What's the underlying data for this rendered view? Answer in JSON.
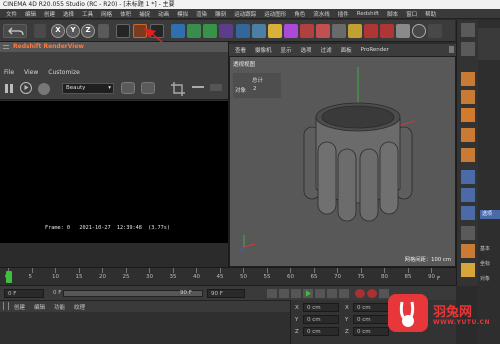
{
  "window": {
    "title": "CINEMA 4D R20.055 Studio (RC - R20) - [未标题 1 *] - 主要"
  },
  "menubar": [
    "文件",
    "编辑",
    "创建",
    "选择",
    "工具",
    "网格",
    "体积",
    "捕捉",
    "动画",
    "模拟",
    "渲染",
    "雕刻",
    "运动跟踪",
    "运动图形",
    "角色",
    "流水线",
    "插件",
    "Redshift",
    "脚本",
    "窗口",
    "帮助"
  ],
  "toolbar": {
    "axes": [
      "X",
      "Y",
      "Z"
    ]
  },
  "renderview": {
    "title": "Redshift RenderView",
    "menu": [
      "File",
      "View",
      "Customize"
    ],
    "beauty_select": "Beauty",
    "frame_label": "Frame: 0",
    "date": "2021-10-27",
    "time": "12:39:48",
    "duration": "(3.77s)"
  },
  "viewport": {
    "menu": [
      "查看",
      "摄像机",
      "显示",
      "选项",
      "过滤",
      "面板",
      "ProRender"
    ],
    "label": "透视视图",
    "stats_header": "总计",
    "stats_label": "对象",
    "stats_value": "2",
    "grid_spacing": "网格间距：100 cm"
  },
  "timeline": {
    "ticks": [
      "0",
      "5",
      "10",
      "15",
      "20",
      "25",
      "30",
      "35",
      "40",
      "45",
      "50",
      "55",
      "60",
      "65",
      "70",
      "75",
      "80",
      "85",
      "90"
    ],
    "unit_suffix": "F"
  },
  "transport": {
    "current": "0 F",
    "start": "0 F",
    "end_field": "90 F",
    "end": "90 F"
  },
  "material_tabs": [
    "创建",
    "编辑",
    "功能",
    "纹理"
  ],
  "coords": {
    "rows": [
      [
        "X",
        "0 cm",
        "X",
        "0 cm"
      ],
      [
        "Y",
        "0 cm",
        "Y",
        "0 cm"
      ],
      [
        "Z",
        "0 cm",
        "Z",
        "0 cm"
      ]
    ]
  },
  "right_panel": {
    "tab": "选项",
    "labels": [
      "基本",
      "坐标",
      "对象"
    ]
  },
  "watermark": {
    "brand": "羽兔网",
    "url": "WWW.YUTU.CN"
  },
  "colors": {
    "accent": "#ff7a3c",
    "arrow": "#e02020",
    "watermark": "#e8373a",
    "model": "#6b6b6b"
  }
}
